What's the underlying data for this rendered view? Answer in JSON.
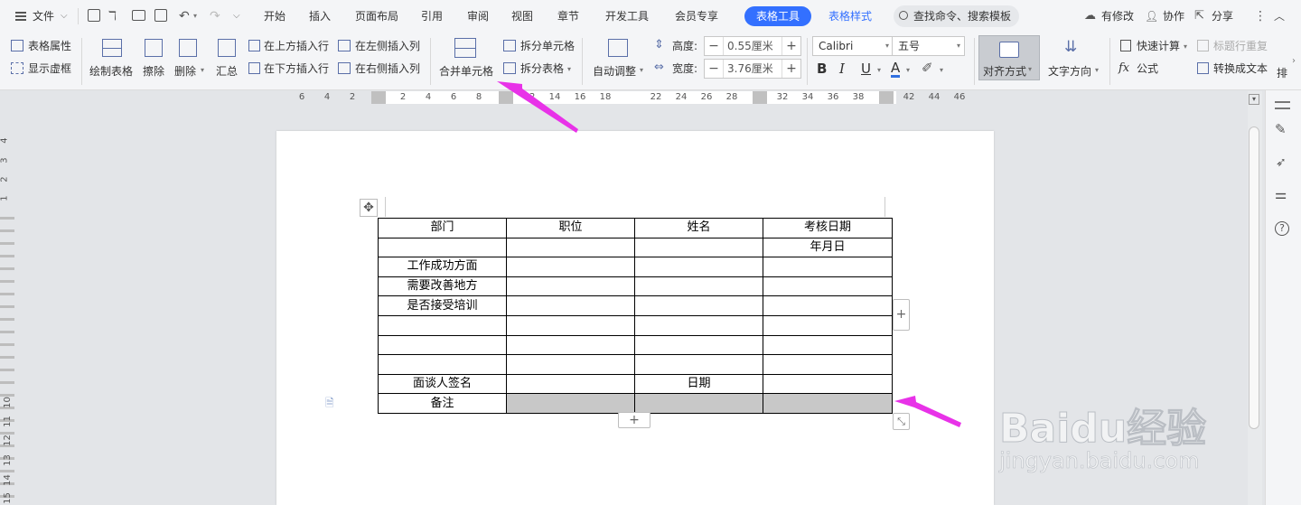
{
  "menubar": {
    "file_label": "文件",
    "tabs": [
      "开始",
      "插入",
      "页面布局",
      "引用",
      "审阅",
      "视图",
      "章节",
      "开发工具",
      "会员专享"
    ],
    "active_tab": "表格工具",
    "style_tab": "表格样式",
    "search_placeholder": "查找命令、搜索模板",
    "changed_label": "有修改",
    "collab_label": "协作",
    "share_label": "分享"
  },
  "ribbon": {
    "table_props": "表格属性",
    "show_grid": "显示虚框",
    "draw_table": "绘制表格",
    "erase": "擦除",
    "delete": "删除",
    "summary": "汇总",
    "insert_above": "在上方插入行",
    "insert_below": "在下方插入行",
    "insert_left": "在左侧插入列",
    "insert_right": "在右侧插入列",
    "merge_cells": "合并单元格",
    "split_cells": "拆分单元格",
    "split_table": "拆分表格",
    "auto_fit": "自动调整",
    "height_label": "高度:",
    "height_value": "0.55厘米",
    "width_label": "宽度:",
    "width_value": "3.76厘米",
    "font_name": "Calibri",
    "font_size": "五号",
    "align": "对齐方式",
    "text_dir": "文字方向",
    "quick_calc": "快速计算",
    "repeat_header": "标题行重复",
    "formula": "公式",
    "to_text": "转换成文本",
    "sort_partial": "排"
  },
  "ruler_h": [
    "6",
    "4",
    "2",
    "2",
    "4",
    "6",
    "8",
    "12",
    "14",
    "16",
    "18",
    "22",
    "24",
    "26",
    "28",
    "32",
    "34",
    "36",
    "38",
    "42",
    "44",
    "46"
  ],
  "ruler_v": [
    "4",
    "3",
    "2",
    "1",
    "10",
    "11",
    "12",
    "13",
    "14",
    "15"
  ],
  "table": {
    "rows": [
      [
        "部门",
        "职位",
        "姓名",
        "考核日期"
      ],
      [
        "",
        "",
        "",
        "年月日"
      ],
      [
        "工作成功方面",
        "",
        "",
        ""
      ],
      [
        "需要改善地方",
        "",
        "",
        ""
      ],
      [
        "是否接受培训",
        "",
        "",
        ""
      ],
      [
        "",
        "",
        "",
        ""
      ],
      [
        "",
        "",
        "",
        ""
      ],
      [
        "",
        "",
        "",
        ""
      ],
      [
        "面谈人签名",
        "",
        "日期",
        ""
      ],
      [
        "备注",
        "",
        "",
        ""
      ]
    ]
  },
  "watermark": {
    "brand": "Baidu经验",
    "url": "jingyan.baidu.com"
  },
  "colors": {
    "accent": "#3370ff",
    "arrow": "#e832e8",
    "selection": "#c8c8c8"
  }
}
